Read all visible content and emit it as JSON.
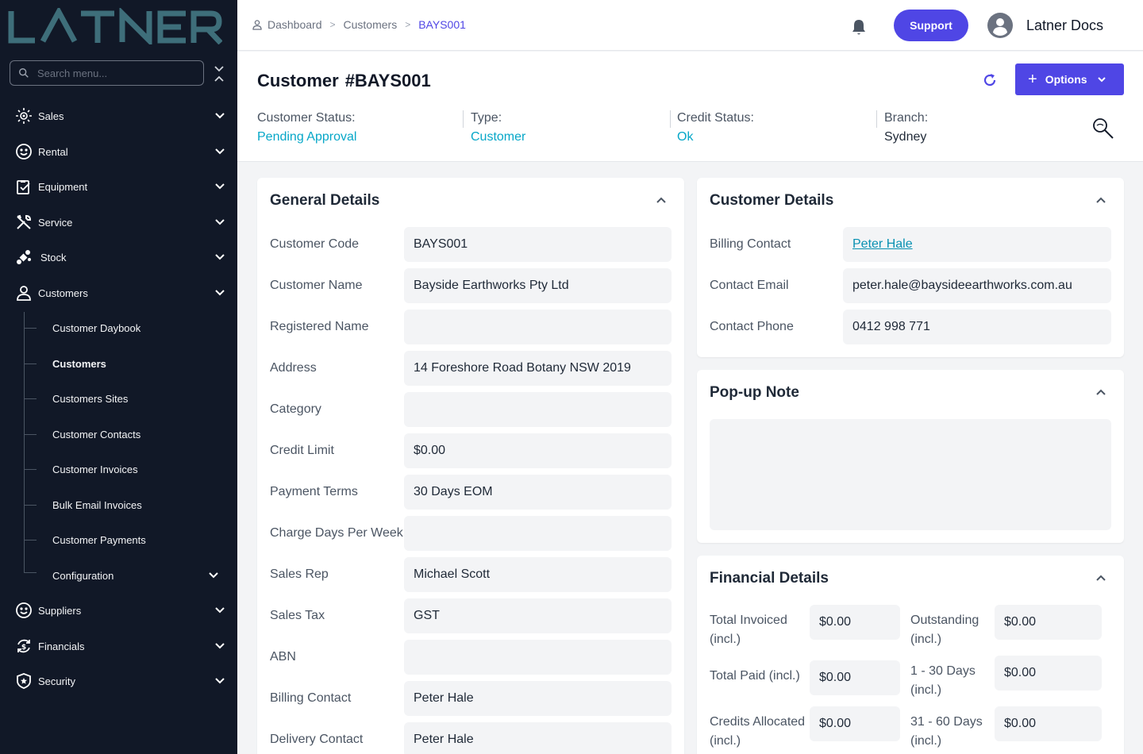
{
  "brand": {
    "logo_text": "LATNER"
  },
  "sidebar": {
    "search_placeholder": "Search menu...",
    "items": [
      {
        "label": "Sales",
        "icon": "sun-icon"
      },
      {
        "label": "Rental",
        "icon": "smile-icon"
      },
      {
        "label": "Equipment",
        "icon": "clipboard-icon"
      },
      {
        "label": "Service",
        "icon": "tools-icon"
      },
      {
        "label": "Stock",
        "icon": "satellite-icon"
      },
      {
        "label": "Customers",
        "icon": "user-icon"
      },
      {
        "label": "Suppliers",
        "icon": "smile-icon"
      },
      {
        "label": "Financials",
        "icon": "dollar-cycle-icon"
      },
      {
        "label": "Security",
        "icon": "shield-icon"
      }
    ],
    "customers_sub": [
      {
        "label": "Customer Daybook"
      },
      {
        "label": "Customers",
        "active": true
      },
      {
        "label": "Customers Sites"
      },
      {
        "label": "Customer Contacts"
      },
      {
        "label": "Customer Invoices"
      },
      {
        "label": "Bulk Email Invoices"
      },
      {
        "label": "Customer Payments"
      },
      {
        "label": "Configuration"
      }
    ]
  },
  "topbar": {
    "breadcrumb": [
      "Dashboard",
      "Customers",
      "BAYS001"
    ],
    "support_label": "Support",
    "user_name": "Latner Docs"
  },
  "header": {
    "title_prefix": "Customer",
    "title_code": "#BAYS001",
    "options_label": "Options",
    "statuses": [
      {
        "label": "Customer Status:",
        "value": "Pending Approval"
      },
      {
        "label": "Type:",
        "value": "Customer"
      },
      {
        "label": "Credit Status:",
        "value": "Ok"
      },
      {
        "label": "Branch:",
        "value": "Sydney"
      }
    ]
  },
  "general": {
    "title": "General Details",
    "fields": [
      {
        "label": "Customer Code",
        "value": "BAYS001"
      },
      {
        "label": "Customer Name",
        "value": "Bayside Earthworks Pty Ltd"
      },
      {
        "label": "Registered Name",
        "value": ""
      },
      {
        "label": "Address",
        "value": "14 Foreshore Road Botany NSW 2019"
      },
      {
        "label": "Category",
        "value": ""
      },
      {
        "label": "Credit Limit",
        "value": "$0.00"
      },
      {
        "label": "Payment Terms",
        "value": "30 Days EOM"
      },
      {
        "label": "Charge Days Per Week",
        "value": ""
      },
      {
        "label": "Sales Rep",
        "value": "Michael Scott"
      },
      {
        "label": "Sales Tax",
        "value": "GST"
      },
      {
        "label": "ABN",
        "value": ""
      },
      {
        "label": "Billing Contact",
        "value": "Peter Hale"
      },
      {
        "label": "Delivery Contact",
        "value": "Peter Hale"
      }
    ]
  },
  "customer_details": {
    "title": "Customer Details",
    "fields": [
      {
        "label": "Billing Contact",
        "value": "Peter Hale"
      },
      {
        "label": "Contact Email",
        "value": "peter.hale@baysideearthworks.com.au"
      },
      {
        "label": "Contact Phone",
        "value": "0412 998 771"
      }
    ]
  },
  "popup_note": {
    "title": "Pop-up Note"
  },
  "financial": {
    "title": "Financial Details",
    "left": [
      {
        "label1": "Total Invoiced",
        "label2": "(incl.)",
        "value": "$0.00"
      },
      {
        "label1": "Total Paid (incl.)",
        "label2": "",
        "value": "$0.00"
      },
      {
        "label1": "Credits Allocated",
        "label2": "(incl.)",
        "value": "$0.00"
      }
    ],
    "right": [
      {
        "label1": "Outstanding",
        "label2": "(incl.)",
        "value": "$0.00"
      },
      {
        "label1": "1 - 30 Days",
        "label2": "(incl.)",
        "value": "$0.00"
      },
      {
        "label1": "31 - 60 Days",
        "label2": "(incl.)",
        "value": "$0.00"
      }
    ]
  },
  "colors": {
    "accent": "#4f46e5",
    "teal": "#06a7c8",
    "sidebar_bg": "#111827"
  }
}
